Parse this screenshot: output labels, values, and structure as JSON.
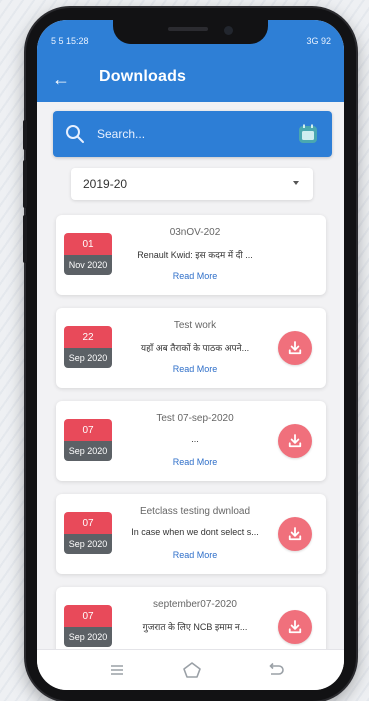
{
  "status": {
    "left": "5 5 15:28",
    "right": "3G 92"
  },
  "header": {
    "title": "Downloads"
  },
  "search": {
    "placeholder": "Search..."
  },
  "filter": {
    "year": "2019-20"
  },
  "items": [
    {
      "day": "01",
      "month": "Nov 2020",
      "title": "03nOV-202",
      "desc": "Renault Kwid: इस कदम में दी ...",
      "read_more": "Read More",
      "download": false
    },
    {
      "day": "22",
      "month": "Sep 2020",
      "title": "Test work",
      "desc": "यहाँ अब तैराकों के पाठक अपने...",
      "read_more": "Read More",
      "download": true
    },
    {
      "day": "07",
      "month": "Sep 2020",
      "title": "Test 07-sep-2020",
      "desc": "...",
      "read_more": "Read More",
      "download": true
    },
    {
      "day": "07",
      "month": "Sep 2020",
      "title": "Eetclass testing dwnload",
      "desc": "In case when we dont select s...",
      "read_more": "Read More",
      "download": true
    },
    {
      "day": "07",
      "month": "Sep 2020",
      "title": "september07-2020",
      "desc": "गुजरात के लिए NCB इमाम न...",
      "read_more": "",
      "download": true
    }
  ],
  "colors": {
    "primary": "#2e7fd6",
    "date_day": "#e84a5a",
    "date_month": "#5c6166",
    "download": "#f0707c",
    "link": "#2f6fc9"
  }
}
